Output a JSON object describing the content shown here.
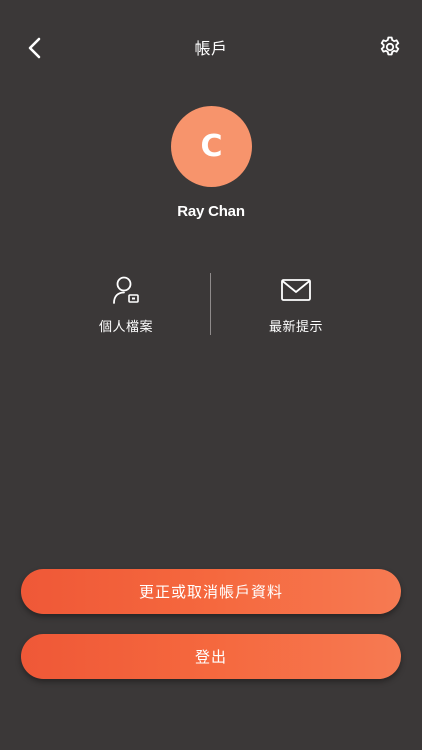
{
  "header": {
    "title": "帳戶",
    "back_icon": "chevron-left-icon",
    "settings_icon": "gear-icon"
  },
  "profile": {
    "avatar_initial": "C",
    "name": "Ray Chan"
  },
  "actions": [
    {
      "label": "個人檔案",
      "icon": "user-card-icon"
    },
    {
      "label": "最新提示",
      "icon": "mail-icon"
    }
  ],
  "buttons": {
    "edit_label": "更正或取消帳戶資料",
    "logout_label": "登出"
  },
  "colors": {
    "background": "#3b3838",
    "avatar": "#f7946c",
    "accent": "#f5683e"
  }
}
